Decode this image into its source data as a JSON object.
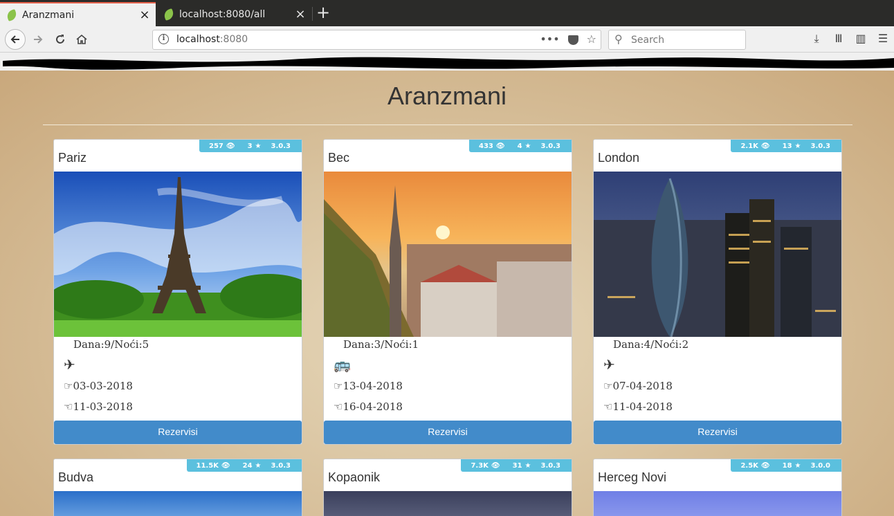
{
  "browser": {
    "tabs": [
      {
        "title": "Aranzmani"
      },
      {
        "title": "localhost:8080/all"
      }
    ],
    "url_host": "localhost",
    "url_port": ":8080",
    "search_placeholder": "Search"
  },
  "page": {
    "title": "Aranzmani",
    "reserve_label": "Rezervisi",
    "cards": [
      {
        "name": "Pariz",
        "views": "257",
        "rating": "3",
        "version": "3.0.3",
        "dana": "Dana:9/Noći:5",
        "transport": "plane-icon",
        "start": "03-03-2018",
        "end": "11-03-2018"
      },
      {
        "name": "Bec",
        "views": "433",
        "rating": "4",
        "version": "3.0.3",
        "dana": "Dana:3/Noći:1",
        "transport": "bus-icon",
        "start": "13-04-2018",
        "end": "16-04-2018"
      },
      {
        "name": "London",
        "views": "2.1K",
        "rating": "13",
        "version": "3.0.3",
        "dana": "Dana:4/Noći:2",
        "transport": "plane-icon",
        "start": "07-04-2018",
        "end": "11-04-2018"
      },
      {
        "name": "Budva",
        "views": "11.5K",
        "rating": "24",
        "version": "3.0.3"
      },
      {
        "name": "Kopaonik",
        "views": "7.3K",
        "rating": "31",
        "version": "3.0.3"
      },
      {
        "name": "Herceg Novi",
        "views": "2.5K",
        "rating": "18",
        "version": "3.0.0"
      }
    ]
  },
  "colors": {
    "badge": "#5bc0de",
    "button": "#428bca",
    "tab_accent": "#e6624c"
  }
}
